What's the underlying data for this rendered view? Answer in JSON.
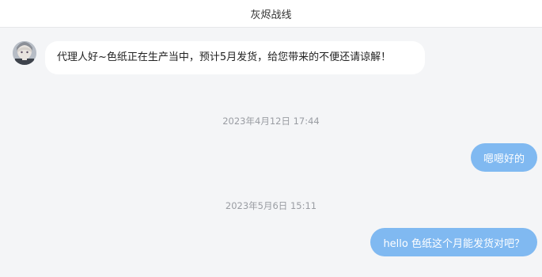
{
  "header": {
    "title": "灰烬战线"
  },
  "messages": [
    {
      "type": "incoming",
      "text": "代理人好~色纸正在生产当中，预计5月发货，给您带来的不便还请谅解！"
    },
    {
      "type": "timestamp",
      "text": "2023年4月12日 17:44"
    },
    {
      "type": "outgoing",
      "text": "嗯嗯好的"
    },
    {
      "type": "timestamp",
      "text": "2023年5月6日 15:11"
    },
    {
      "type": "outgoing",
      "text": "hello 色纸这个月能发货对吧？"
    }
  ],
  "colors": {
    "header_bg": "#ffffff",
    "chat_bg": "#f4f5f7",
    "incoming_bubble": "#ffffff",
    "outgoing_bubble": "#80b9f1",
    "timestamp_text": "#9a9da3"
  },
  "icons": {
    "sender_avatar": "character-avatar"
  }
}
